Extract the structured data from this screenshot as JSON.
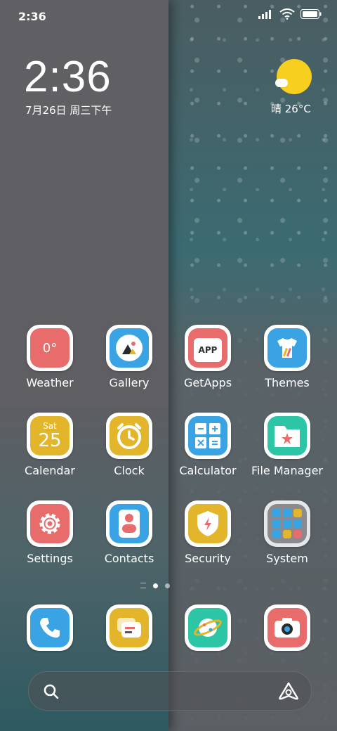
{
  "status_bar": {
    "time": "2:36"
  },
  "lockclock": {
    "time": "2:36",
    "date": "7月26日 周三下午"
  },
  "weather_widget": {
    "text": "晴 26°C"
  },
  "apps": [
    {
      "label": "Weather",
      "glyph": "0°",
      "icon": "weather-icon",
      "color": "#e86c6c"
    },
    {
      "label": "Gallery",
      "icon": "gallery-icon",
      "color": "#3aa3e3"
    },
    {
      "label": "GetApps",
      "glyph": "APP",
      "icon": "getapps-icon",
      "color": "#e86c6c"
    },
    {
      "label": "Themes",
      "icon": "themes-icon",
      "color": "#3aa3e3"
    },
    {
      "label": "Calendar",
      "glyph_day": "Sat",
      "glyph_num": "25",
      "icon": "calendar-icon",
      "color": "#e3b52a"
    },
    {
      "label": "Clock",
      "icon": "clock-icon",
      "color": "#e3b52a"
    },
    {
      "label": "Calculator",
      "icon": "calculator-icon",
      "color": "#3aa3e3"
    },
    {
      "label": "File Manager",
      "icon": "folder-icon",
      "color": "#2cc6a6"
    },
    {
      "label": "Settings",
      "icon": "gear-icon",
      "color": "#e86c6c"
    },
    {
      "label": "Contacts",
      "icon": "contacts-icon",
      "color": "#3aa3e3"
    },
    {
      "label": "Security",
      "icon": "shield-icon",
      "color": "#e3b52a"
    },
    {
      "label": "System",
      "icon": "folder-grid-icon",
      "color": "#8a8a8f"
    }
  ],
  "dock": [
    {
      "icon": "phone-icon",
      "color": "#3aa3e3"
    },
    {
      "icon": "messages-icon",
      "color": "#e3b52a"
    },
    {
      "icon": "browser-icon",
      "color": "#2cc6a6"
    },
    {
      "icon": "camera-icon",
      "color": "#e86c6c"
    }
  ],
  "search": {
    "search_icon": "search-icon",
    "assistant_icon": "assistant-icon"
  }
}
